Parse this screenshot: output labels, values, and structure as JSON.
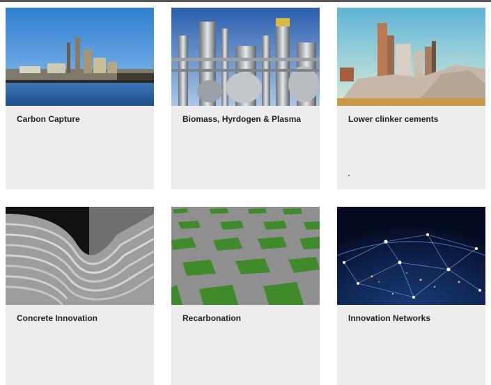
{
  "cards": [
    {
      "title": "Carbon Capture",
      "image": "industrial-plant-waterfront-image"
    },
    {
      "title": "Biomass, Hyrdogen & Plasma",
      "image": "refinery-tanks-pipes-image"
    },
    {
      "title": "Lower clinker cements",
      "image": "cement-plant-gravel-image"
    },
    {
      "title": "Concrete Innovation",
      "image": "3d-printed-concrete-layers-image"
    },
    {
      "title": "Recarbonation",
      "image": "grass-paver-grid-image"
    },
    {
      "title": "Innovation Networks",
      "image": "earth-night-network-image"
    }
  ],
  "colors": {
    "card_background": "#ececec",
    "title_text": "#222222"
  }
}
